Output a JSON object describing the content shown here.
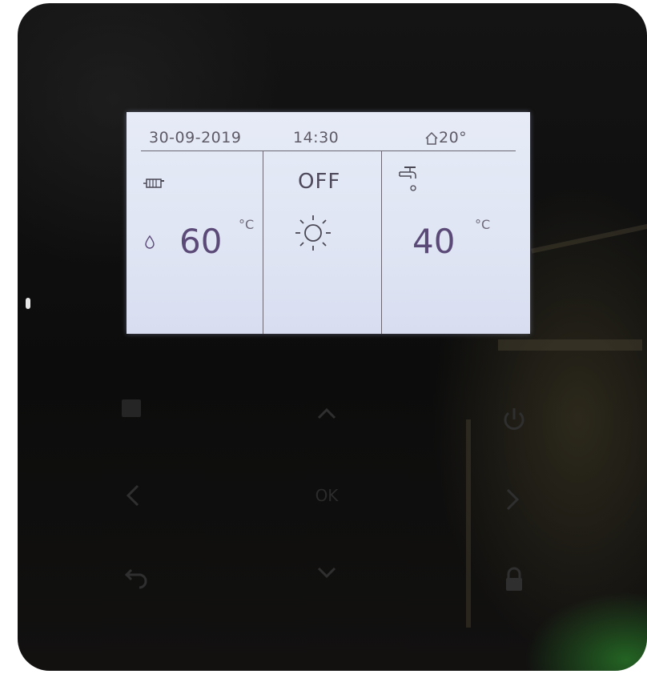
{
  "display": {
    "date": "30-09-2019",
    "time": "14:30",
    "room_temp": "20°",
    "space_heating": {
      "value": "60",
      "unit": "°C",
      "icon": "radiator-icon"
    },
    "mode": {
      "status": "OFF",
      "icon": "sun-icon"
    },
    "hot_water": {
      "value": "40",
      "unit": "°C",
      "icon": "faucet-icon"
    }
  },
  "buttons": {
    "menu": "menu-button",
    "up": "up-arrow-button",
    "power": "power-button",
    "left": "left-arrow-button",
    "ok_label": "OK",
    "right": "right-arrow-button",
    "back": "back-button",
    "down": "down-arrow-button",
    "lock": "lock-button"
  }
}
